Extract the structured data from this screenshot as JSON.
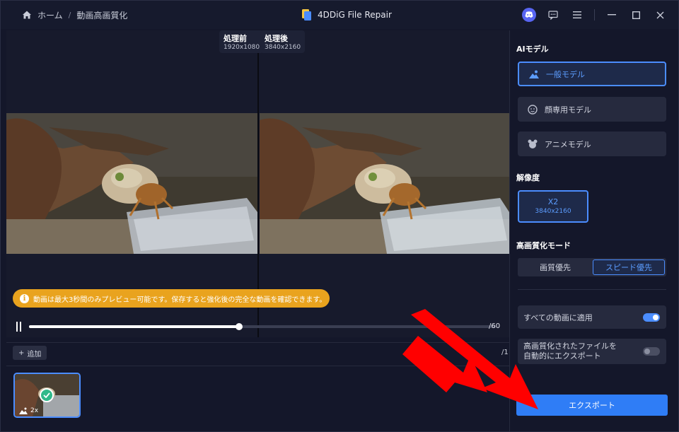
{
  "breadcrumb": {
    "home": "ホーム",
    "separator": "/",
    "current": "動画高画質化"
  },
  "app": {
    "title": "4DDiG File Repair"
  },
  "window_icons": [
    "discord-icon",
    "feedback-icon",
    "menu-icon",
    "minimize-icon",
    "maximize-icon",
    "close-icon"
  ],
  "preview": {
    "before_label": "処理前",
    "before_res": "1920x1080",
    "after_label": "処理後",
    "after_res": "3840x2160",
    "notice": "動画は最大3秒間のみプレビュー可能です。保存すると強化後の完全な動画を確認できます。",
    "progress": 0.45,
    "time": "/60"
  },
  "strip": {
    "add_label": "追加",
    "page_count": "/1",
    "thumb_scale": "2x"
  },
  "sidebar": {
    "ai_model_title": "AIモデル",
    "models": [
      {
        "label": "一般モデル",
        "icon": "landscape-icon",
        "active": true
      },
      {
        "label": "顔専用モデル",
        "icon": "face-icon",
        "active": false
      },
      {
        "label": "アニメモデル",
        "icon": "anime-icon",
        "active": false
      }
    ],
    "resolution_title": "解像度",
    "resolution": {
      "scale": "X2",
      "size": "3840x2160"
    },
    "mode_title": "高画質化モード",
    "modes": [
      {
        "label": "画質優先",
        "active": false
      },
      {
        "label": "スピード優先",
        "active": true
      }
    ],
    "apply_all": {
      "label": "すべての動画に適用",
      "on": true
    },
    "auto_export": {
      "line1": "高画質化されたファイルを",
      "line2": "自動的にエクスポート",
      "on": false
    },
    "export_label": "エクスポート"
  },
  "colors": {
    "accent": "#4b8dff",
    "export": "#2f7df6",
    "notice": "#e9a31e",
    "arrow": "#ff0000"
  }
}
